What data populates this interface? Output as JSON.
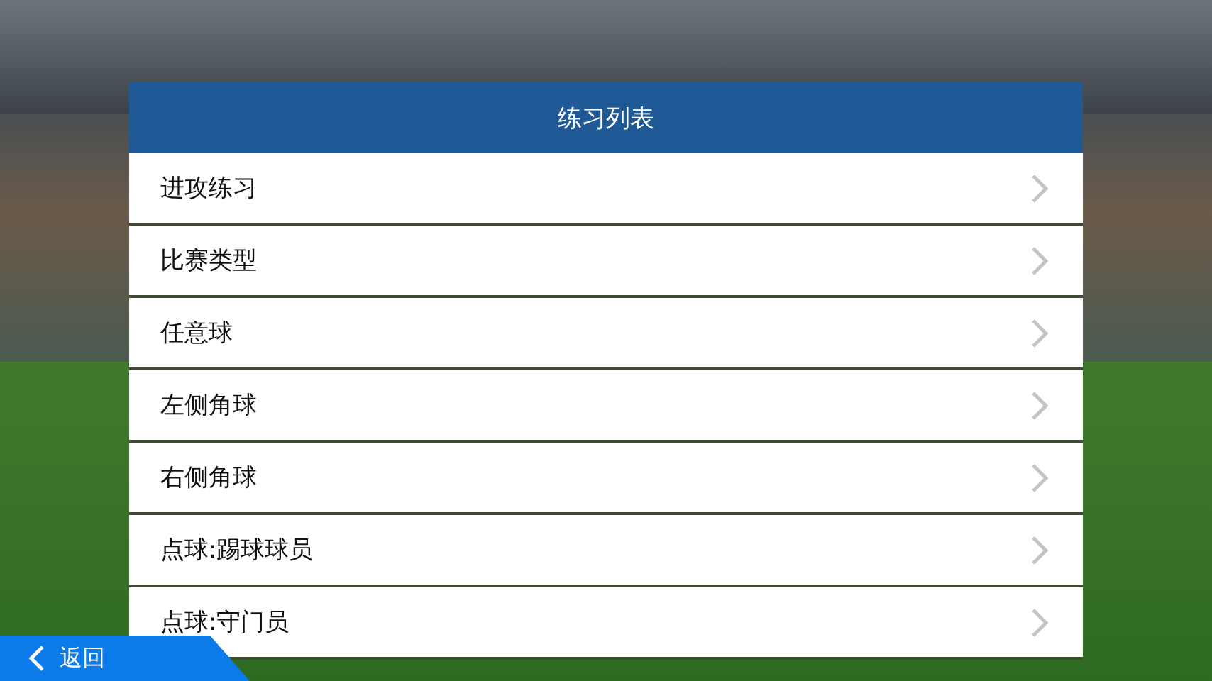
{
  "panel": {
    "title": "练习列表"
  },
  "items": [
    {
      "label": "进攻练习"
    },
    {
      "label": "比赛类型"
    },
    {
      "label": "任意球"
    },
    {
      "label": "左侧角球"
    },
    {
      "label": "右侧角球"
    },
    {
      "label": "点球:踢球球员"
    },
    {
      "label": "点球:守门员"
    }
  ],
  "back_button": {
    "label": "返回"
  }
}
